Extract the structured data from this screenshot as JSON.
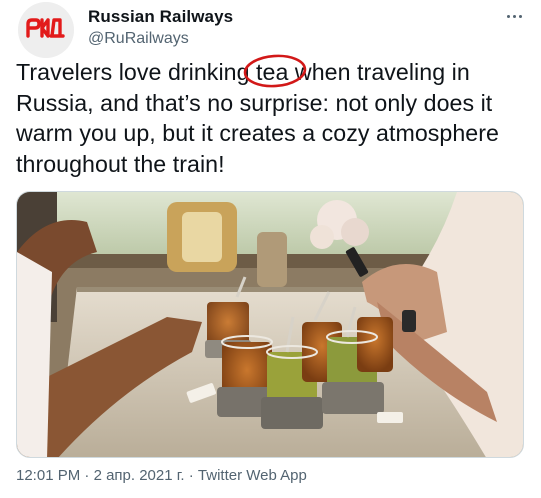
{
  "account": {
    "display_name": "Russian Railways",
    "handle": "@RuRailways",
    "logo_text": "РЖД"
  },
  "tweet": {
    "text_before": "Travelers love drinking ",
    "highlight_word": "tea",
    "text_after": " when traveling in Russia, and that’s no surprise: not only does it warm you up, but it creates a cozy atmosphere throughout the train!",
    "image_description_icon": "photo-tea-glasses-in-holders-on-train-table"
  },
  "footer": {
    "time": "12:01 PM",
    "separator": " · ",
    "date": "2 апр. 2021 г.",
    "source": "Twitter Web App"
  },
  "colors": {
    "brand_red": "#e21a1a",
    "text": "#0f1419",
    "secondary": "#536471",
    "annotation_circle": "#d21818"
  },
  "icons": {
    "more": "more-horizontal-icon",
    "avatar": "rzd-logo-icon"
  }
}
